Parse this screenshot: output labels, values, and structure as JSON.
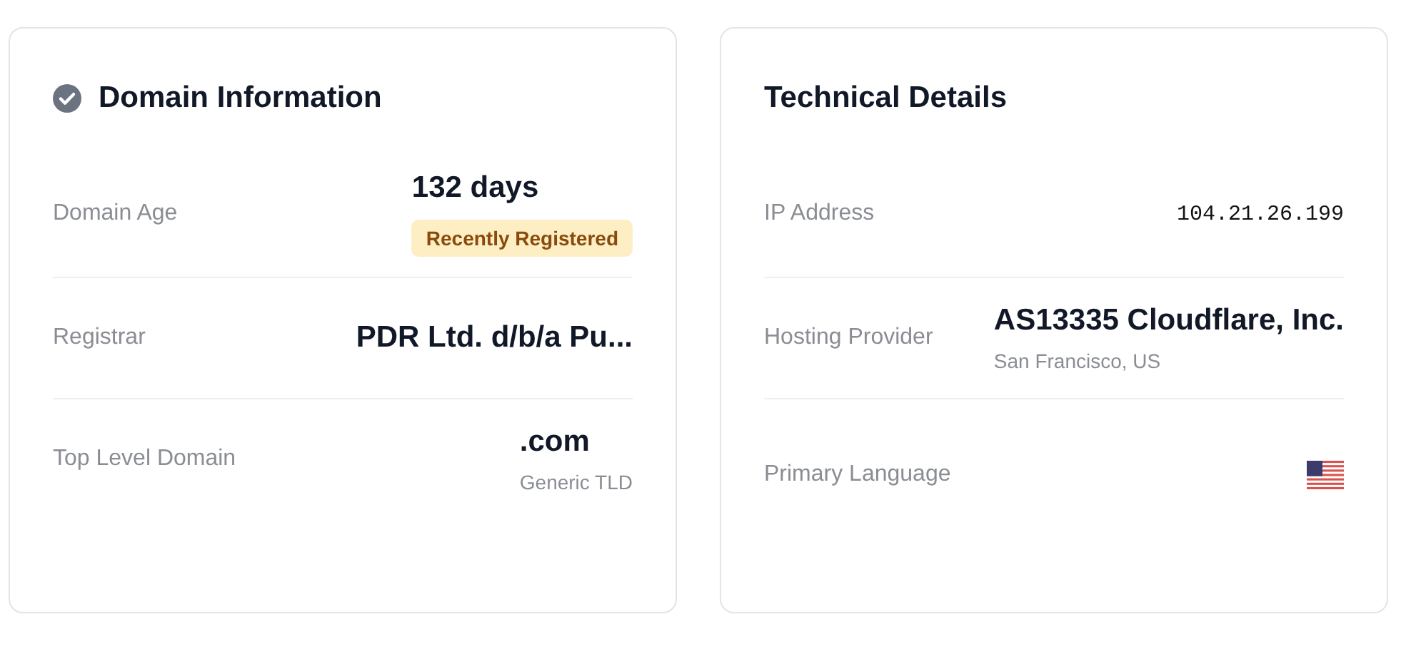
{
  "cards": [
    {
      "title": "Domain Information",
      "verified": true,
      "rows": [
        {
          "kind": "text",
          "label": "Domain Age",
          "value": "132 days",
          "badge": "Recently Registered"
        },
        {
          "kind": "text",
          "label": "Registrar",
          "value": "PDR Ltd. d/b/a Pu..."
        },
        {
          "kind": "text",
          "label": "Top Level Domain",
          "value": ".com",
          "sub": "Generic TLD"
        }
      ]
    },
    {
      "title": "Technical Details",
      "verified": false,
      "rows": [
        {
          "kind": "mono",
          "label": "IP Address",
          "value": "104.21.26.199"
        },
        {
          "kind": "text",
          "label": "Hosting Provider",
          "value": "AS13335 Cloudflare, Inc.",
          "sub": "San Francisco, US"
        },
        {
          "kind": "flag",
          "label": "Primary Language"
        }
      ]
    }
  ]
}
